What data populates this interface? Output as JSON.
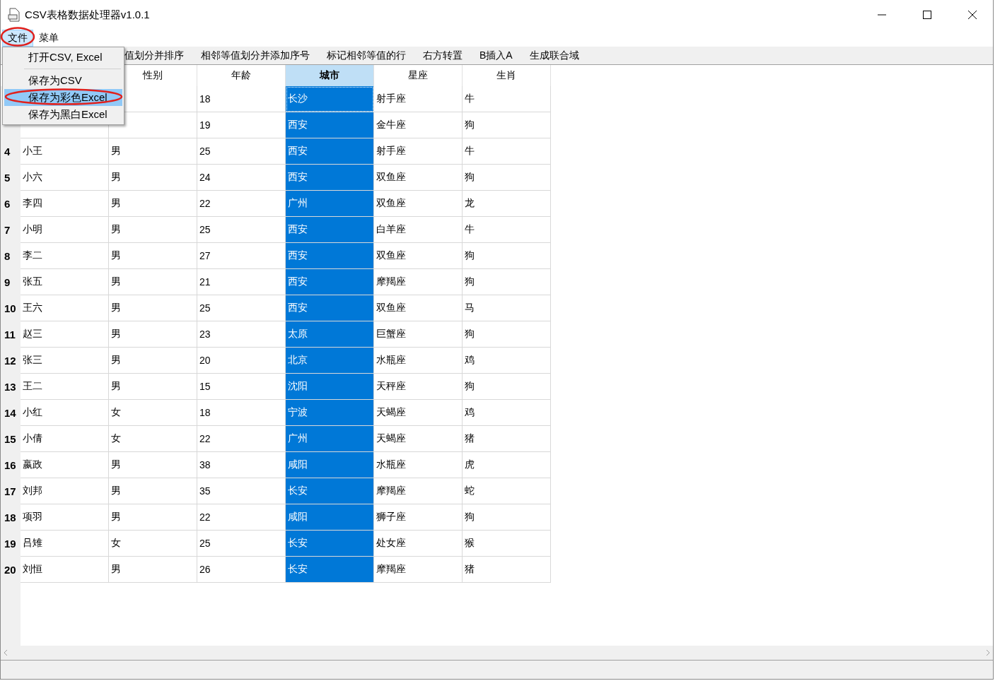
{
  "window": {
    "title": "CSV表格数据处理器v1.0.1"
  },
  "menubar": [
    {
      "label": "文件",
      "selected": true
    },
    {
      "label": "菜单",
      "selected": false
    }
  ],
  "file_menu": [
    {
      "label": "打开CSV, Excel",
      "selected": false
    },
    {
      "label": "保存为CSV",
      "selected": false,
      "separator_before": true
    },
    {
      "label": "保存为彩色Excel",
      "selected": true
    },
    {
      "label": "保存为黑白Excel",
      "selected": false
    }
  ],
  "toolbar": [
    "值划分并排序",
    "相邻等值划分并添加序号",
    "标记相邻等值的行",
    "右方转置",
    "B插入A",
    "生成联合域"
  ],
  "table": {
    "columns": [
      {
        "label": "性别",
        "selected": false
      },
      {
        "label": "年龄",
        "selected": false
      },
      {
        "label": "城市",
        "selected": true
      },
      {
        "label": "星座",
        "selected": false
      },
      {
        "label": "生肖",
        "selected": false
      }
    ],
    "rows": [
      {
        "cells": [
          null,
          null,
          "18",
          "长沙",
          "射手座",
          "牛"
        ],
        "focused": true
      },
      {
        "cells": [
          null,
          null,
          "19",
          "西安",
          "金牛座",
          "狗"
        ]
      },
      {
        "number": "4",
        "cells": [
          "小王",
          "男",
          "25",
          "西安",
          "射手座",
          "牛"
        ]
      },
      {
        "number": "5",
        "cells": [
          "小六",
          "男",
          "24",
          "西安",
          "双鱼座",
          "狗"
        ]
      },
      {
        "number": "6",
        "cells": [
          "李四",
          "男",
          "22",
          "广州",
          "双鱼座",
          "龙"
        ]
      },
      {
        "number": "7",
        "cells": [
          "小明",
          "男",
          "25",
          "西安",
          "白羊座",
          "牛"
        ]
      },
      {
        "number": "8",
        "cells": [
          "李二",
          "男",
          "27",
          "西安",
          "双鱼座",
          "狗"
        ]
      },
      {
        "number": "9",
        "cells": [
          "张五",
          "男",
          "21",
          "西安",
          "摩羯座",
          "狗"
        ]
      },
      {
        "number": "10",
        "cells": [
          "王六",
          "男",
          "25",
          "西安",
          "双鱼座",
          "马"
        ]
      },
      {
        "number": "11",
        "cells": [
          "赵三",
          "男",
          "23",
          "太原",
          "巨蟹座",
          "狗"
        ]
      },
      {
        "number": "12",
        "cells": [
          "张三",
          "男",
          "20",
          "北京",
          "水瓶座",
          "鸡"
        ]
      },
      {
        "number": "13",
        "cells": [
          "王二",
          "男",
          "15",
          "沈阳",
          "天秤座",
          "狗"
        ]
      },
      {
        "number": "14",
        "cells": [
          "小红",
          "女",
          "18",
          "宁波",
          "天蝎座",
          "鸡"
        ]
      },
      {
        "number": "15",
        "cells": [
          "小倩",
          "女",
          "22",
          "广州",
          "天蝎座",
          "猪"
        ]
      },
      {
        "number": "16",
        "cells": [
          "嬴政",
          "男",
          "38",
          "咸阳",
          "水瓶座",
          "虎"
        ]
      },
      {
        "number": "17",
        "cells": [
          "刘邦",
          "男",
          "35",
          "长安",
          "摩羯座",
          "蛇"
        ]
      },
      {
        "number": "18",
        "cells": [
          "项羽",
          "男",
          "22",
          "咸阳",
          "狮子座",
          "狗"
        ]
      },
      {
        "number": "19",
        "cells": [
          "吕雉",
          "女",
          "25",
          "长安",
          "处女座",
          "猴"
        ]
      },
      {
        "number": "20",
        "cells": [
          "刘恒",
          "男",
          "26",
          "长安",
          "摩羯座",
          "猪"
        ]
      }
    ]
  }
}
